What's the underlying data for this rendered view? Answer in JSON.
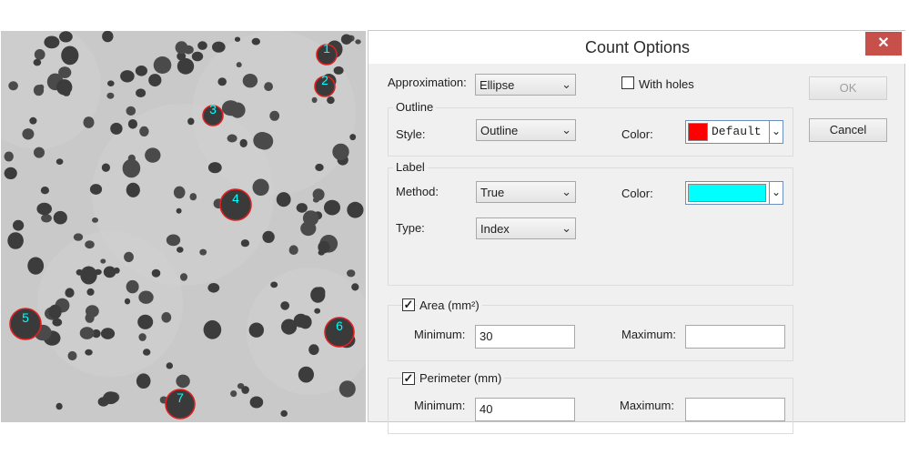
{
  "dialog": {
    "title": "Count Options",
    "close_glyph": "✕",
    "ok_label": "OK",
    "cancel_label": "Cancel",
    "approximation": {
      "label": "Approximation:",
      "value": "Ellipse"
    },
    "with_holes": {
      "label": "With holes",
      "checked": false
    },
    "outline": {
      "group_title": "Outline",
      "style_label": "Style:",
      "style_value": "Outline",
      "color_label": "Color:",
      "color_text": "Default",
      "color_hex": "#ff0000"
    },
    "label": {
      "group_title": "Label",
      "method_label": "Method:",
      "method_value": "True",
      "color_label": "Color:",
      "color_hex": "#00ffff",
      "type_label": "Type:",
      "type_value": "Index"
    },
    "area": {
      "checkbox_label": "Area (mm²)",
      "checked": true,
      "min_label": "Minimum:",
      "min_value": "30",
      "max_label": "Maximum:",
      "max_value": ""
    },
    "perimeter": {
      "checkbox_label": "Perimeter (mm)",
      "checked": true,
      "min_label": "Minimum:",
      "min_value": "40",
      "max_label": "Maximum:",
      "max_value": ""
    }
  },
  "image": {
    "outline_color": "#e02020",
    "label_color": "#00ffff",
    "particle_labels": [
      "1",
      "2",
      "3",
      "4",
      "5",
      "6",
      "7"
    ]
  },
  "icons": {
    "dropdown": "chevron-down-icon",
    "check": "check-icon"
  }
}
